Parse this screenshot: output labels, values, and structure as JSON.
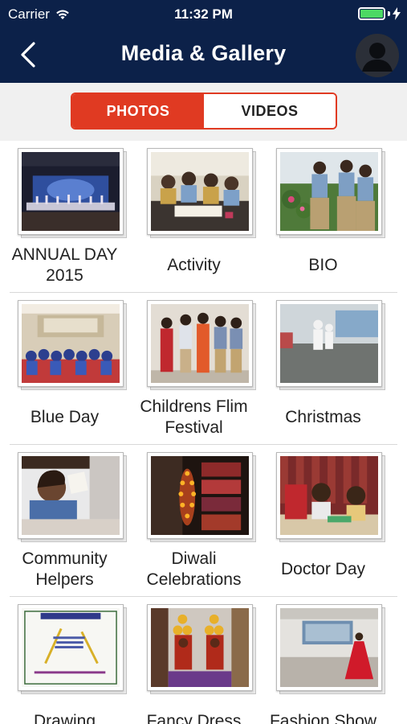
{
  "status_bar": {
    "carrier": "Carrier",
    "time": "11:32 PM",
    "wifi_icon": "wifi-icon",
    "battery_icon": "battery-icon",
    "charging_icon": "bolt-icon",
    "battery_color": "#4cd964"
  },
  "header": {
    "title": "Media & Gallery",
    "back_icon": "chevron-left-icon",
    "avatar_icon": "user-avatar-icon",
    "background": "#0c2149"
  },
  "tabs": {
    "photos": "PHOTOS",
    "videos": "VIDEOS",
    "selected": "PHOTOS",
    "accent": "#e03a22"
  },
  "albums": [
    {
      "title": "ANNUAL DAY 2015"
    },
    {
      "title": "Activity"
    },
    {
      "title": "BIO"
    },
    {
      "title": "Blue Day"
    },
    {
      "title": "Childrens Flim Festival"
    },
    {
      "title": "Christmas"
    },
    {
      "title": "Community Helpers"
    },
    {
      "title": "Diwali Celebrations"
    },
    {
      "title": "Doctor Day"
    },
    {
      "title": "Drawing"
    },
    {
      "title": "Fancy Dress"
    },
    {
      "title": "Fashion Show"
    }
  ]
}
